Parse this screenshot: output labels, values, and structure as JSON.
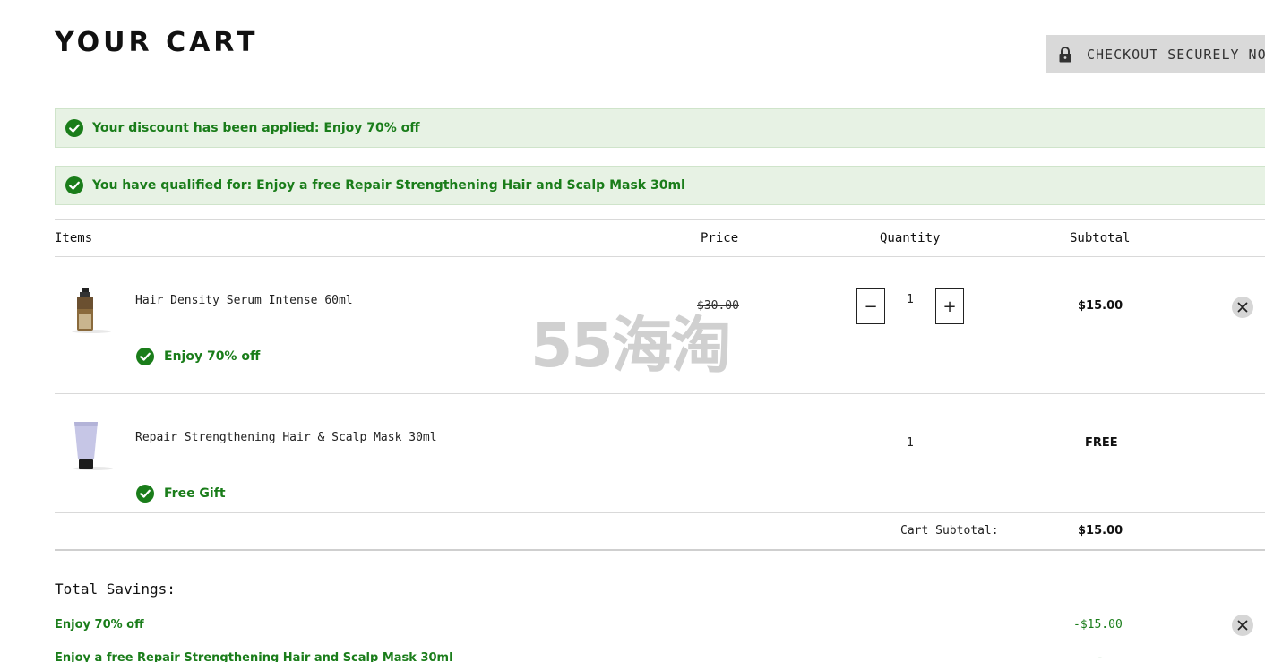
{
  "header": {
    "title": "YOUR CART",
    "checkout_label": "CHECKOUT SECURELY NOW"
  },
  "banners": [
    {
      "text": "Your discount has been applied: Enjoy 70% off"
    },
    {
      "text": "You have qualified for: Enjoy a free Repair Strengthening Hair and Scalp Mask 30ml"
    }
  ],
  "columns": {
    "items": "Items",
    "price": "Price",
    "quantity": "Quantity",
    "subtotal": "Subtotal"
  },
  "cart_items": [
    {
      "name": "Hair Density Serum Intense 60ml",
      "promo": "Enjoy 70% off",
      "price": "$30.00",
      "quantity": "1",
      "decrement_label": "−",
      "increment_label": "+",
      "subtotal": "$15.00"
    },
    {
      "name": "Repair Strengthening Hair & Scalp Mask 30ml",
      "promo": "Free Gift",
      "quantity": "1",
      "subtotal": "FREE"
    }
  ],
  "cart_subtotal": {
    "label": "Cart Subtotal:",
    "value": "$15.00"
  },
  "savings": {
    "title": "Total Savings:",
    "items": [
      {
        "label": "Enjoy 70% off",
        "amount": "-$15.00"
      },
      {
        "label": "Enjoy a free Repair Strengthening Hair and Scalp Mask 30ml",
        "amount": "-"
      }
    ]
  },
  "watermark": "55海淘",
  "colors": {
    "success_green": "#1a7d1a",
    "banner_bg": "#e7f2e4",
    "checkout_bg": "#d9d9d9"
  },
  "icons": {
    "checkout": "lock-icon",
    "banner": "check-circle-icon",
    "remove": "close-icon"
  }
}
